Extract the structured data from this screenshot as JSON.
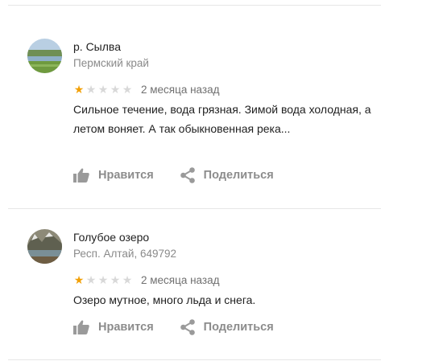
{
  "reviews": [
    {
      "place": "р. Сылва",
      "region": "Пермский край",
      "rating": 1,
      "rating_max": 5,
      "date": "2 месяца назад",
      "text": "Сильное течение, вода грязная. Зимой вода холодная, а летом воняет. А так обыкновенная река...",
      "like_label": "Нравится",
      "share_label": "Поделиться"
    },
    {
      "place": "Голубое озеро",
      "region": "Респ. Алтай, 649792",
      "rating": 1,
      "rating_max": 5,
      "date": "2 месяца назад",
      "text": "Озеро мутное, много льда и снега.",
      "like_label": "Нравится",
      "share_label": "Поделиться"
    }
  ],
  "colors": {
    "star_on": "#f2a007",
    "star_off": "#d8d8d8",
    "action": "#8c8c8c",
    "divider": "#e6e6e6"
  },
  "icons": [
    "thumb-up-icon",
    "share-icon",
    "star-icon"
  ]
}
